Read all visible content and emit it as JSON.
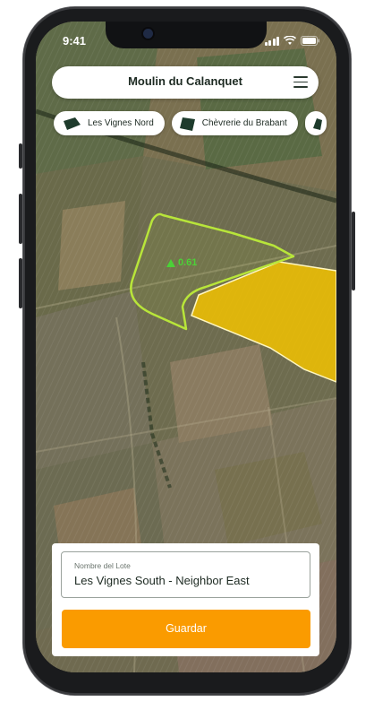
{
  "status_bar": {
    "time": "9:41"
  },
  "header": {
    "title": "Moulin du Calanquet",
    "menu_icon": "hamburger-menu-icon"
  },
  "field_chips": [
    {
      "label": "Les Vignes Nord",
      "icon": "field-shape-icon"
    },
    {
      "label": "Chèvrerie du Brabant",
      "icon": "field-shape-icon"
    }
  ],
  "map": {
    "polygon_label": "0.61",
    "polygon_marker_icon": "triangle-marker-icon",
    "colors": {
      "outline": "#b8e53a",
      "selected_fill": "#f2c200",
      "label": "#4cd137"
    }
  },
  "form": {
    "lot_name_label": "Nombre del Lote",
    "lot_name_value": "Les Vignes South - Neighbor East",
    "save_label": "Guardar"
  },
  "colors": {
    "accent": "#fa9b00",
    "chip_icon": "#1e3b2c"
  }
}
